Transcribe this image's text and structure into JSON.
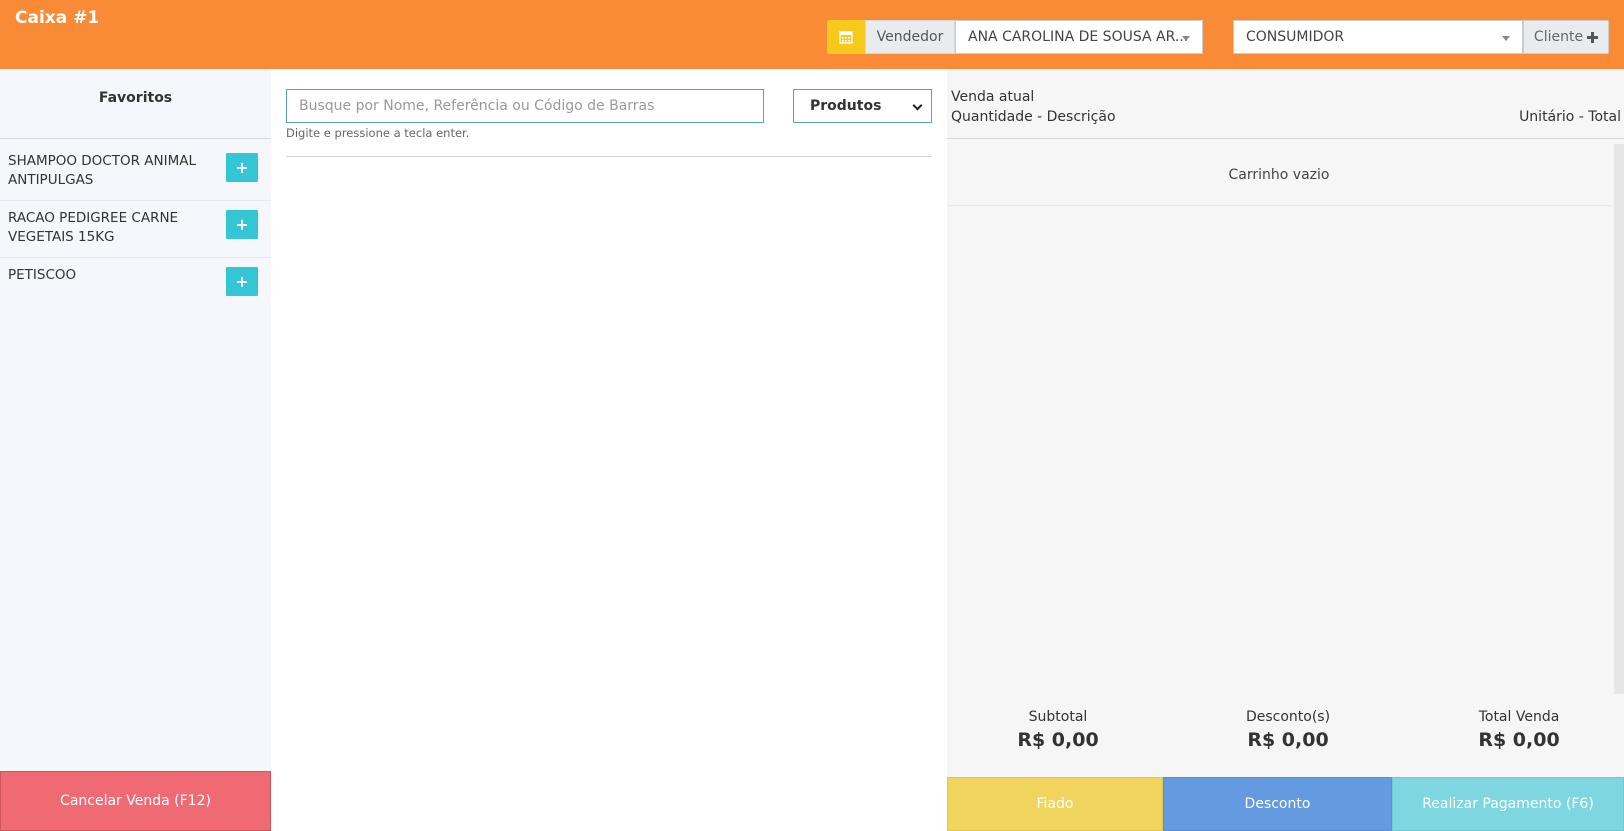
{
  "header": {
    "title": "Caixa #1",
    "calendar_icon": "calendar-icon",
    "vendor_label": "Vendedor",
    "vendor_value": "ANA CAROLINA DE SOUSA AR...",
    "client_value": "CONSUMIDOR",
    "client_button_label": "Cliente",
    "client_button_icon": "plus-icon",
    "colors": {
      "header_bg": "#f98a36",
      "calendar_bg": "#f7c91c"
    }
  },
  "favorites": {
    "title": "Favoritos",
    "items": [
      {
        "label": "SHAMPOO DOCTOR ANIMAL ANTIPULGAS",
        "add_icon": "plus-icon"
      },
      {
        "label": "RACAO PEDIGREE CARNE VEGETAIS 15KG",
        "add_icon": "plus-icon"
      },
      {
        "label": "PETISCOO",
        "add_icon": "plus-icon"
      }
    ],
    "cancel_label": "Cancelar Venda (F12)"
  },
  "search": {
    "placeholder": "Busque por Nome, Referência ou Código de Barras",
    "hint": "Digite e pressione a tecla enter.",
    "filter_selected": "Produtos"
  },
  "cart": {
    "heading": "Venda atual",
    "col_left": "Quantidade - Descrição",
    "col_right": "Unitário - Total",
    "empty_text": "Carrinho vazio",
    "totals": {
      "subtotal_label": "Subtotal",
      "subtotal_value": "R$ 0,00",
      "discount_label": "Desconto(s)",
      "discount_value": "R$ 0,00",
      "total_label": "Total Venda",
      "total_value": "R$ 0,00"
    },
    "buttons": {
      "fiado": "Fiado",
      "desconto": "Desconto",
      "pagamento": "Realizar Pagamento (F6)"
    }
  }
}
